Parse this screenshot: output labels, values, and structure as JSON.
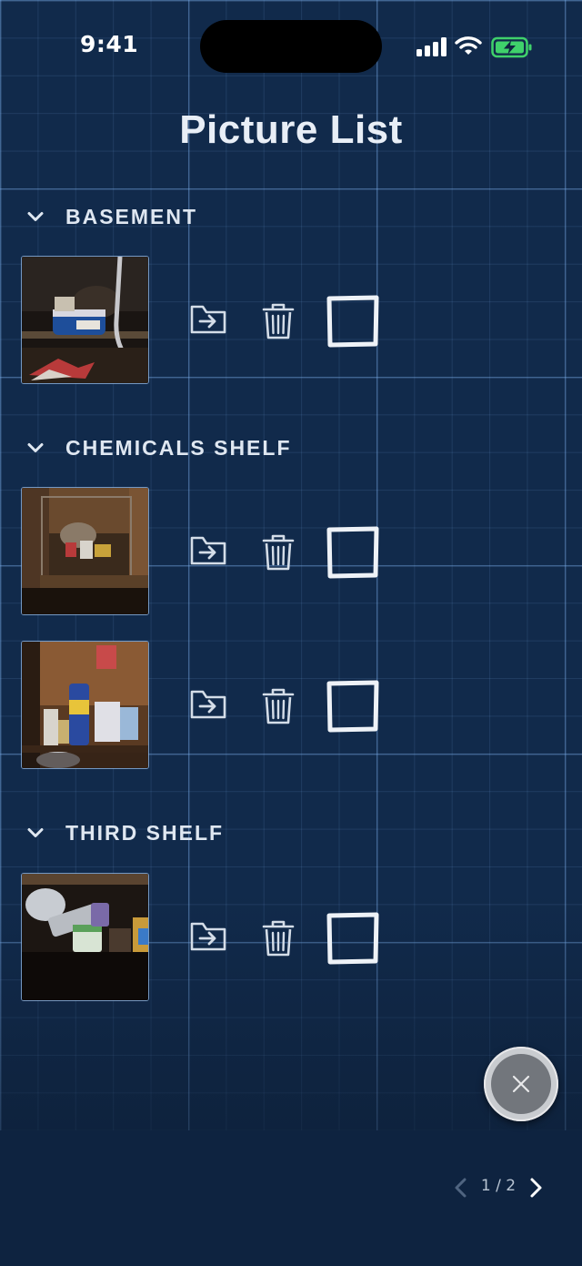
{
  "status_bar": {
    "time": "9:41"
  },
  "header": {
    "title": "Picture List"
  },
  "sections": [
    {
      "label": "BASEMENT",
      "photos": [
        {
          "scene": "basement"
        }
      ]
    },
    {
      "label": "CHEMICALS SHELF",
      "photos": [
        {
          "scene": "chemicals-1"
        },
        {
          "scene": "chemicals-2"
        }
      ]
    },
    {
      "label": "THIRD SHELF",
      "photos": [
        {
          "scene": "third-shelf"
        }
      ]
    }
  ],
  "row_actions": {
    "move_icon": "folder-move-icon",
    "delete_icon": "trash-icon",
    "select_icon": "checkbox-icon"
  },
  "fab": {
    "icon": "close-icon"
  },
  "pagination": {
    "text": "1 / 2",
    "current": 1,
    "total": 2
  },
  "colors": {
    "background": "#112a4b",
    "grid_line": "#78aae6",
    "text": "#e6eef8",
    "battery": "#3fd16b"
  }
}
